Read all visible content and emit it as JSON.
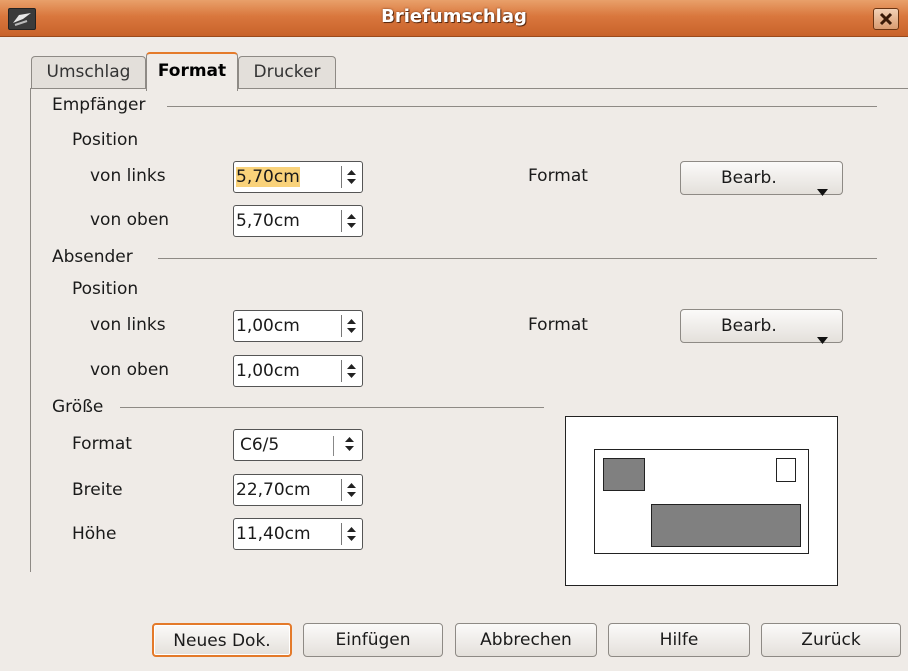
{
  "window": {
    "title": "Briefumschlag"
  },
  "tabs": [
    {
      "label": "Umschlag",
      "active": false
    },
    {
      "label": "Format",
      "active": true
    },
    {
      "label": "Drucker",
      "active": false
    }
  ],
  "recipient": {
    "section_label": "Empfänger",
    "position_label": "Position",
    "left_label": "von links",
    "left_value": "5,70cm",
    "top_label": "von oben",
    "top_value": "5,70cm",
    "format_label": "Format",
    "edit_button": "Bearb."
  },
  "sender": {
    "section_label": "Absender",
    "position_label": "Position",
    "left_label": "von links",
    "left_value": "1,00cm",
    "top_label": "von oben",
    "top_value": "1,00cm",
    "format_label": "Format",
    "edit_button": "Bearb."
  },
  "size": {
    "section_label": "Größe",
    "format_label": "Format",
    "format_value": "C6/5",
    "width_label": "Breite",
    "width_value": "22,70cm",
    "height_label": "Höhe",
    "height_value": "11,40cm"
  },
  "buttons": {
    "new_doc": "Neues Dok.",
    "insert": "Einfügen",
    "cancel": "Abbrechen",
    "help": "Hilfe",
    "back": "Zurück"
  },
  "colors": {
    "titlebar": "#d9773d",
    "accent": "#e47a2a",
    "selection": "#f9d27a"
  }
}
